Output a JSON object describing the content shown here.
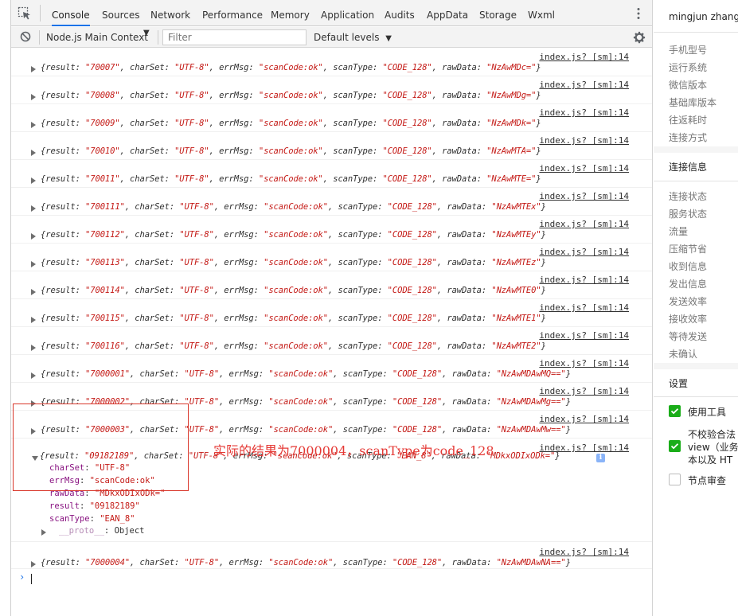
{
  "tabs": [
    {
      "label": "Console",
      "active": true
    },
    {
      "label": "Sources"
    },
    {
      "label": "Network"
    },
    {
      "label": "Performance"
    },
    {
      "label": "Memory"
    },
    {
      "label": "Application"
    },
    {
      "label": "Audits"
    },
    {
      "label": "AppData"
    },
    {
      "label": "Storage"
    },
    {
      "label": "Wxml"
    }
  ],
  "toolbar": {
    "context": "Node.js Main Context",
    "filter_placeholder": "Filter",
    "levels": "Default levels"
  },
  "icons": {
    "inspect": "inspect-element-icon",
    "more": "more-vertical-icon",
    "clear": "clear-console-icon",
    "gear": "settings-gear-icon",
    "expand": "expand-triangle-icon",
    "info": "info-icon"
  },
  "colors": {
    "active_tab": "#1a73e8",
    "string": "#c41a16",
    "property_key": "#881280",
    "annotation": "#e53935",
    "checkbox_on": "#1aad19"
  },
  "console": {
    "source": "index.js? [sm]:14",
    "messages": [
      {
        "result": "\"70007\"",
        "charSet": "\"UTF-8\"",
        "errMsg": "\"scanCode:ok\"",
        "scanType": "\"CODE_128\"",
        "rawData": "\"NzAwMDc=\""
      },
      {
        "result": "\"70008\"",
        "charSet": "\"UTF-8\"",
        "errMsg": "\"scanCode:ok\"",
        "scanType": "\"CODE_128\"",
        "rawData": "\"NzAwMDg=\""
      },
      {
        "result": "\"70009\"",
        "charSet": "\"UTF-8\"",
        "errMsg": "\"scanCode:ok\"",
        "scanType": "\"CODE_128\"",
        "rawData": "\"NzAwMDk=\""
      },
      {
        "result": "\"70010\"",
        "charSet": "\"UTF-8\"",
        "errMsg": "\"scanCode:ok\"",
        "scanType": "\"CODE_128\"",
        "rawData": "\"NzAwMTA=\""
      },
      {
        "result": "\"70011\"",
        "charSet": "\"UTF-8\"",
        "errMsg": "\"scanCode:ok\"",
        "scanType": "\"CODE_128\"",
        "rawData": "\"NzAwMTE=\""
      },
      {
        "result": "\"700111\"",
        "charSet": "\"UTF-8\"",
        "errMsg": "\"scanCode:ok\"",
        "scanType": "\"CODE_128\"",
        "rawData": "\"NzAwMTEx\""
      },
      {
        "result": "\"700112\"",
        "charSet": "\"UTF-8\"",
        "errMsg": "\"scanCode:ok\"",
        "scanType": "\"CODE_128\"",
        "rawData": "\"NzAwMTEy\""
      },
      {
        "result": "\"700113\"",
        "charSet": "\"UTF-8\"",
        "errMsg": "\"scanCode:ok\"",
        "scanType": "\"CODE_128\"",
        "rawData": "\"NzAwMTEz\""
      },
      {
        "result": "\"700114\"",
        "charSet": "\"UTF-8\"",
        "errMsg": "\"scanCode:ok\"",
        "scanType": "\"CODE_128\"",
        "rawData": "\"NzAwMTE0\""
      },
      {
        "result": "\"700115\"",
        "charSet": "\"UTF-8\"",
        "errMsg": "\"scanCode:ok\"",
        "scanType": "\"CODE_128\"",
        "rawData": "\"NzAwMTE1\""
      },
      {
        "result": "\"700116\"",
        "charSet": "\"UTF-8\"",
        "errMsg": "\"scanCode:ok\"",
        "scanType": "\"CODE_128\"",
        "rawData": "\"NzAwMTE2\""
      },
      {
        "result": "\"7000001\"",
        "charSet": "\"UTF-8\"",
        "errMsg": "\"scanCode:ok\"",
        "scanType": "\"CODE_128\"",
        "rawData": "\"NzAwMDAwMQ==\""
      },
      {
        "result": "\"7000002\"",
        "charSet": "\"UTF-8\"",
        "errMsg": "\"scanCode:ok\"",
        "scanType": "\"CODE_128\"",
        "rawData": "\"NzAwMDAwMg==\""
      },
      {
        "result": "\"7000003\"",
        "charSet": "\"UTF-8\"",
        "errMsg": "\"scanCode:ok\"",
        "scanType": "\"CODE_128\"",
        "rawData": "\"NzAwMDAwMw==\""
      }
    ],
    "expanded": {
      "summary": {
        "result": "\"09182189\"",
        "charSet": "\"UTF-8\"",
        "errMsg": "\"scanCode:ok\"",
        "scanType": "\"EAN_8\"",
        "rawData": "\"MDkxODIxODk=\""
      },
      "properties": [
        {
          "key": "charSet",
          "value": "\"UTF-8\""
        },
        {
          "key": "errMsg",
          "value": "\"scanCode:ok\""
        },
        {
          "key": "rawData",
          "value": "\"MDkxODIxODk=\""
        },
        {
          "key": "result",
          "value": "\"09182189\""
        },
        {
          "key": "scanType",
          "value": "\"EAN_8\""
        }
      ],
      "proto_key": "__proto__",
      "proto_value": "Object"
    },
    "last": {
      "result": "\"7000004\"",
      "charSet": "\"UTF-8\"",
      "errMsg": "\"scanCode:ok\"",
      "scanType": "\"CODE_128\"",
      "rawData": "\"NzAwMDAwNA==\""
    },
    "annotation": "实际的结果为7000004，scanType为code_128",
    "prompt": "›"
  },
  "side_panel": {
    "title": "mingjun zhang",
    "device_items": [
      "手机型号",
      "运行系统",
      "微信版本",
      "基础库版本",
      "往返耗时",
      "连接方式"
    ],
    "connection_header": "连接信息",
    "connection_items": [
      "连接状态",
      "服务状态",
      "流量",
      "压缩节省",
      "收到信息",
      "发出信息",
      "发送效率",
      "接收效率",
      "等待发送",
      "未确认"
    ],
    "settings_header": "设置",
    "settings": [
      {
        "label": "使用工具",
        "checked": true
      },
      {
        "label_lines": [
          "不校验合法",
          "view（业务",
          "本以及 HT"
        ],
        "checked": true
      },
      {
        "label": "节点审查",
        "checked": false
      }
    ]
  }
}
